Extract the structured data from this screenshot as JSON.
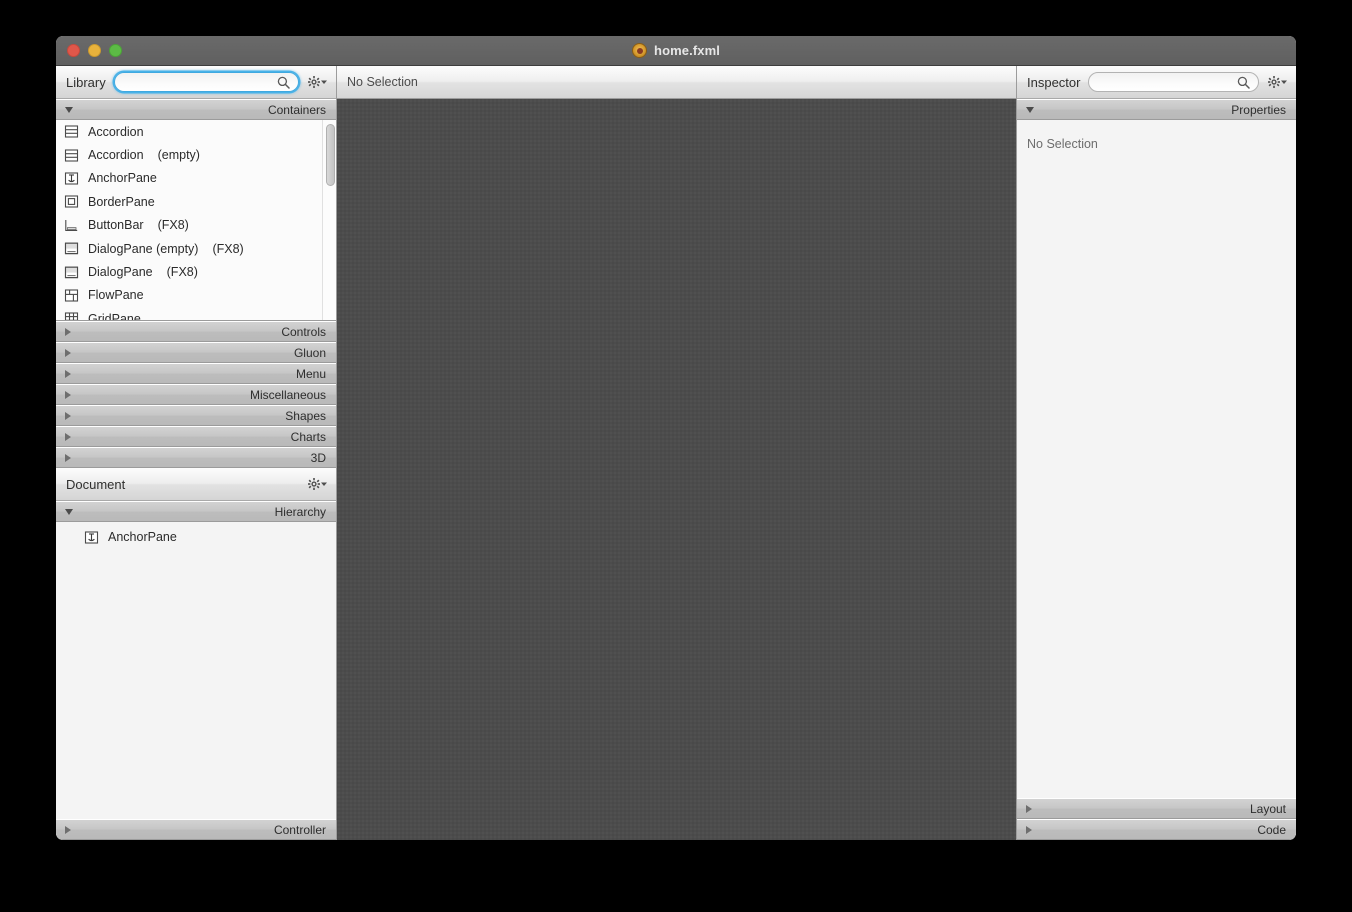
{
  "window": {
    "title": "home.fxml",
    "doc_icon": "fxml-document-icon",
    "traffic_lights": [
      {
        "name": "close",
        "color": "#e0574a"
      },
      {
        "name": "minimize",
        "color": "#e8b23c"
      },
      {
        "name": "zoom",
        "color": "#5cbb45"
      }
    ]
  },
  "library": {
    "title": "Library",
    "search": {
      "value": "",
      "placeholder": "",
      "icon": "search-icon",
      "focused": true
    },
    "gear": {
      "icon": "gear-icon",
      "caret": "caret-down-icon"
    },
    "expanded_section": {
      "label": "Containers",
      "state": "expanded"
    },
    "items": [
      {
        "name": "Accordion",
        "suffix": "",
        "icon": "accordion-icon"
      },
      {
        "name": "Accordion",
        "suffix": "(empty)",
        "icon": "accordion-icon"
      },
      {
        "name": "AnchorPane",
        "suffix": "",
        "icon": "anchorpane-icon"
      },
      {
        "name": "BorderPane",
        "suffix": "",
        "icon": "borderpane-icon"
      },
      {
        "name": "ButtonBar",
        "suffix": "(FX8)",
        "icon": "buttonbar-icon"
      },
      {
        "name": "DialogPane (empty)",
        "suffix": "(FX8)",
        "icon": "dialogpane-icon"
      },
      {
        "name": "DialogPane",
        "suffix": "(FX8)",
        "icon": "dialogpane-icon"
      },
      {
        "name": "FlowPane",
        "suffix": "",
        "icon": "flowpane-icon"
      },
      {
        "name": "GridPane",
        "suffix": "",
        "icon": "gridpane-icon"
      }
    ],
    "collapsed_sections": [
      {
        "label": "Controls"
      },
      {
        "label": "Gluon"
      },
      {
        "label": "Menu"
      },
      {
        "label": "Miscellaneous"
      },
      {
        "label": "Shapes"
      },
      {
        "label": "Charts"
      },
      {
        "label": "3D"
      }
    ]
  },
  "document": {
    "title": "Document",
    "gear": {
      "icon": "gear-icon",
      "caret": "caret-down-icon"
    },
    "hierarchy": {
      "label": "Hierarchy",
      "state": "expanded"
    },
    "tree": [
      {
        "name": "AnchorPane",
        "icon": "anchorpane-icon"
      }
    ],
    "controller": {
      "label": "Controller",
      "state": "collapsed"
    }
  },
  "content": {
    "selection_status": "No Selection"
  },
  "inspector": {
    "title": "Inspector",
    "search": {
      "value": "",
      "placeholder": "",
      "icon": "search-icon",
      "focused": false
    },
    "gear": {
      "icon": "gear-icon",
      "caret": "caret-down-icon"
    },
    "properties": {
      "label": "Properties",
      "state": "expanded"
    },
    "empty_text": "No Selection",
    "sections": [
      {
        "label": "Layout"
      },
      {
        "label": "Code"
      }
    ]
  }
}
